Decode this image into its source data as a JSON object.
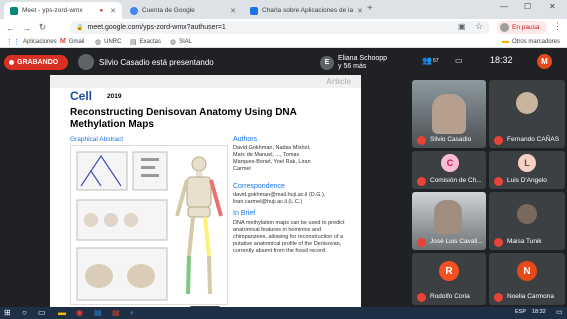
{
  "tabs": [
    {
      "label": "Meet - yps-zord-wmx",
      "active": true
    },
    {
      "label": "Cuenta de Google",
      "active": false
    },
    {
      "label": "Charla sobre Aplicaciones de la",
      "active": false
    }
  ],
  "toolbar": {
    "url": "meet.google.com/yps-zord-wmx?authuser=1",
    "pause_label": "En pausa"
  },
  "bookmarks": [
    {
      "label": "Aplicaciones"
    },
    {
      "label": "Gmail"
    },
    {
      "label": "UNRC"
    },
    {
      "label": "Exactas"
    },
    {
      "label": "SIAL"
    }
  ],
  "bookmarks_other": "Otros marcadores",
  "meet": {
    "recording_label": "GRABANDO",
    "presenter_text": "Silvio Casadio está presentando",
    "eliana_name": "Eliana Schoopp",
    "eliana_more": "y 56 más",
    "eliana_initial": "E",
    "participants_count": "57",
    "time": "18:32",
    "self_initial": "M"
  },
  "slide": {
    "corner_label": "Article",
    "journal": "Cell",
    "year": "2019",
    "title": "Reconstructing Denisovan Anatomy Using DNA Methylation Maps",
    "graphical_abstract": "Graphical Abstract",
    "authors_heading": "Authors",
    "authors": "David Gokhman, Nadav Mishol, Marc de Manuel, ..., Tomas Marques-Bonet, Yoel Rak, Liran Carmel",
    "correspondence_heading": "Correspondence",
    "correspondence": "david.gokhman@mail.huji.ac.il (D.G.), liran.carmel@huji.ac.il (L.C.)",
    "in_brief_heading": "In Brief",
    "in_brief": "DNA methylation maps can be used to predict anatomical features in hominins and chimpanzees, allowing for reconstruction of a putative anatomical profile of the Denisovan, currently absent from the fossil record."
  },
  "participants": [
    {
      "name": "Silvio Casadio",
      "type": "video"
    },
    {
      "name": "Fernando CAÑAS",
      "type": "photo"
    },
    {
      "name": "Comisión de Ch...",
      "type": "initial",
      "initial": "C",
      "color": "#f8bbd0",
      "initial_color": "#c2185b"
    },
    {
      "name": "Luis D'Angelo",
      "type": "initial",
      "initial": "L",
      "color": "#f3d2c1",
      "initial_color": "#6d4c41"
    },
    {
      "name": "José Luis Cavall...",
      "type": "video"
    },
    {
      "name": "Maisa Tunik",
      "type": "photo"
    },
    {
      "name": "Rodolfo Coria",
      "type": "initial",
      "initial": "R",
      "color": "#f4511e",
      "initial_color": "#ffffff"
    },
    {
      "name": "Noelia Carmona",
      "type": "initial",
      "initial": "N",
      "color": "#e64a19",
      "initial_color": "#ffffff"
    }
  ],
  "taskbar": {
    "lang": "ESP",
    "time": "18:32"
  }
}
